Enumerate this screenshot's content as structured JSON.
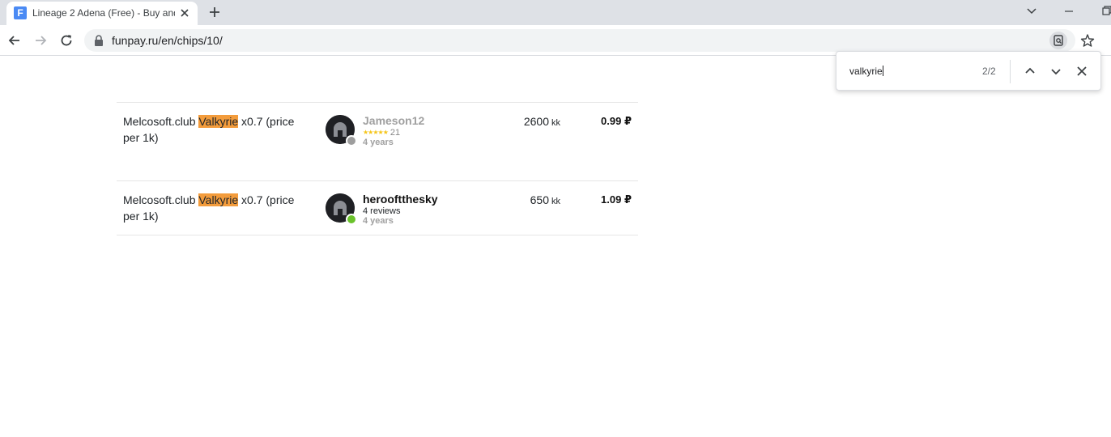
{
  "tab": {
    "title": "Lineage 2 Adena (Free) - Buy and",
    "favicon_letter": "F"
  },
  "address": {
    "url": "funpay.ru/en/chips/10/"
  },
  "find": {
    "query": "valkyrie",
    "count": "2/2"
  },
  "offers": [
    {
      "desc_before": "Melcosoft.club ",
      "desc_match": "Valkyrie",
      "desc_after": " x0.7 (price per 1k)",
      "seller": "Jameson12",
      "seller_color": "#a0a0a0",
      "status_color": "#9e9e9e",
      "stars": "★★★★★",
      "reviews": "21",
      "age": "4 years",
      "amount": "2600",
      "unit": "kk",
      "price": "0.99 ₽"
    },
    {
      "desc_before": "Melcosoft.club ",
      "desc_match": "Valkyrie",
      "desc_after": " x0.7 (price per 1k)",
      "seller": "herooftthesky",
      "seller_color": "#111111",
      "status_color": "#6ac22b",
      "reviews_text": "4 reviews",
      "age": "4 years",
      "amount": "650",
      "unit": "kk",
      "price": "1.09 ₽"
    }
  ],
  "icons": [
    "close-icon",
    "plus-icon",
    "back-arrow-icon",
    "forward-arrow-icon",
    "reload-icon",
    "lock-icon",
    "lens-icon",
    "star-icon",
    "chevron-up-icon",
    "chevron-down-icon",
    "minimize-icon",
    "restore-icon",
    "tab-list-icon",
    "helmet-avatar-icon"
  ],
  "colors": {
    "highlight": "#f39c3c",
    "online": "#6ac22b",
    "offline": "#9e9e9e",
    "stars": "#f5c518"
  }
}
